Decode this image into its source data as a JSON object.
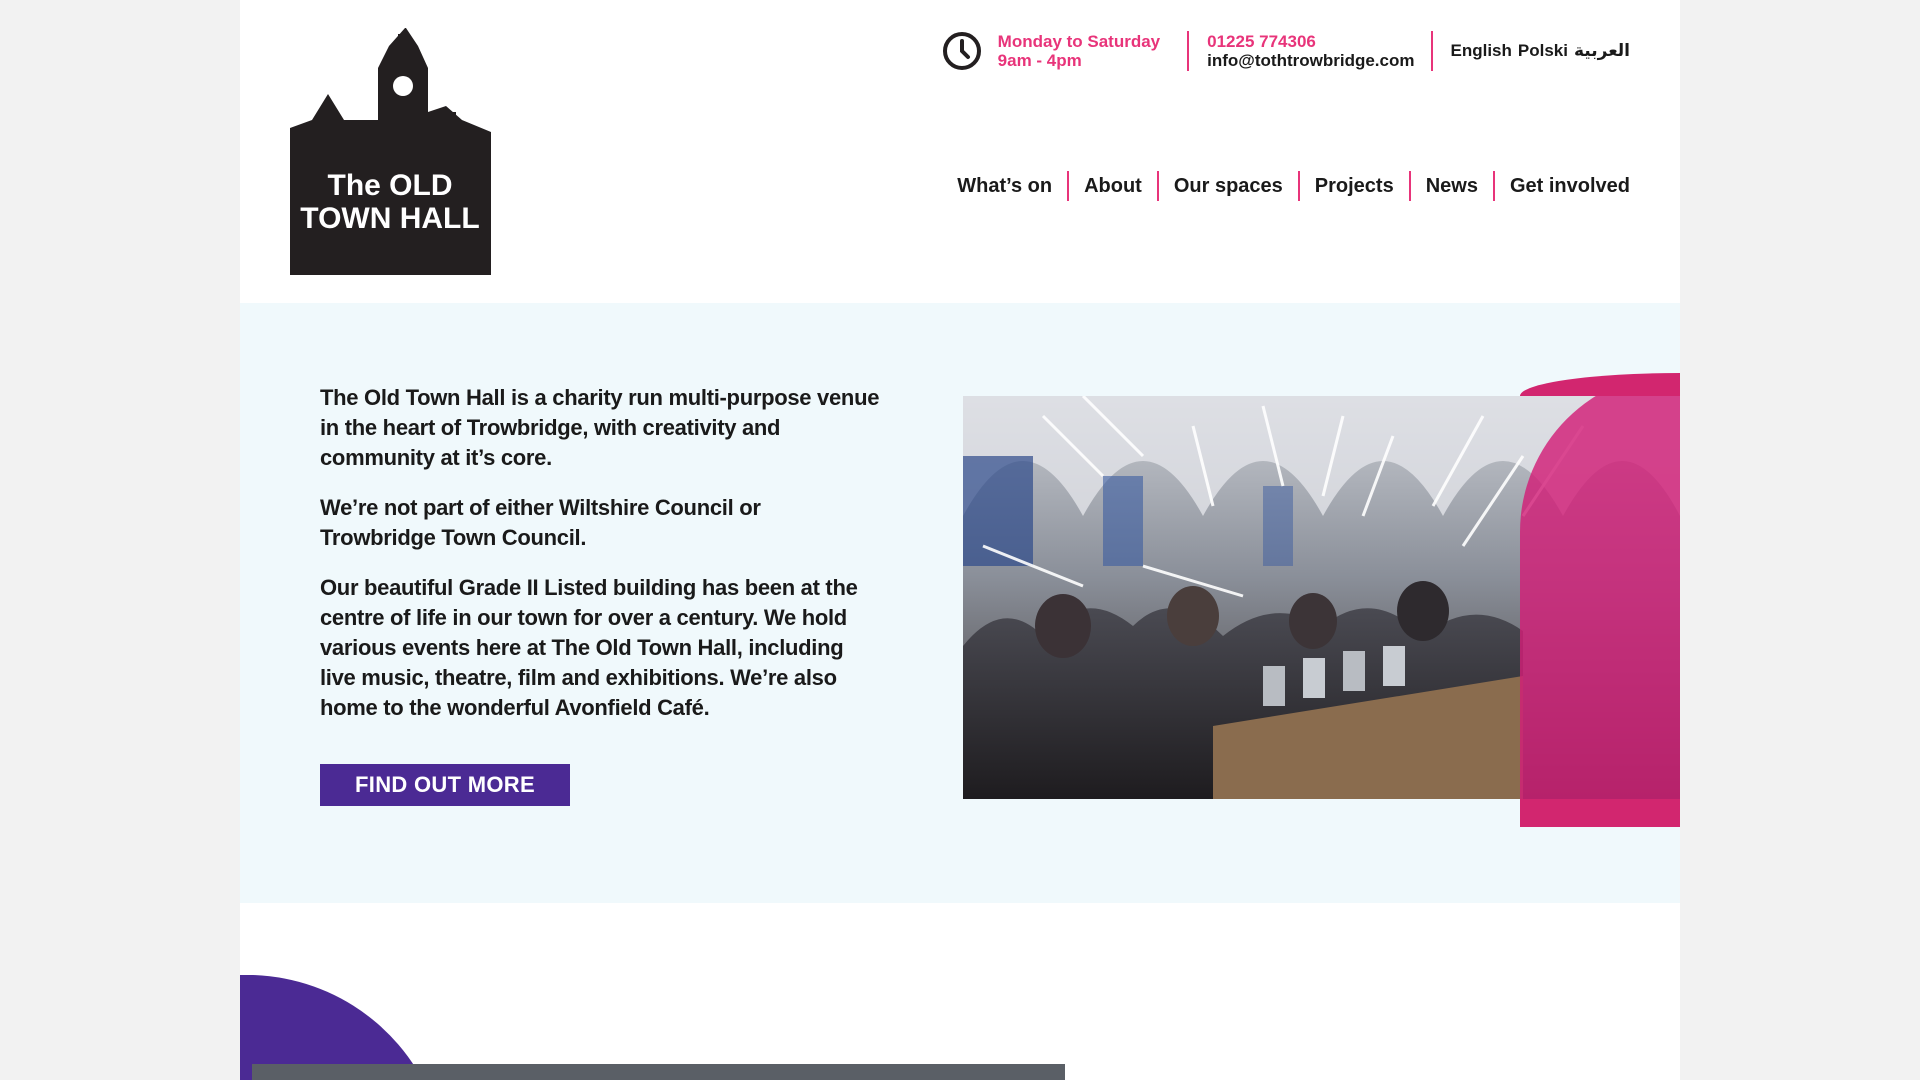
{
  "brand": {
    "logo_line1": "The OLD",
    "logo_line2": "TOWN HALL",
    "colors": {
      "pink": "#e8347a",
      "purple": "#4b2a94",
      "dark": "#231f20",
      "hero_bg": "#f0f9fc"
    }
  },
  "info_bar": {
    "clock_icon": "clock-icon",
    "hours_days": "Monday to Saturday",
    "hours_time": "9am - 4pm",
    "phone": "01225 774306",
    "email": "info@tothtrowbridge.com",
    "languages": [
      "English",
      "Polski",
      "العربية"
    ]
  },
  "nav": {
    "items": [
      "What’s on",
      "About",
      "Our spaces",
      "Projects",
      "News",
      "Get involved"
    ]
  },
  "hero": {
    "paragraphs": [
      "The Old Town Hall is a charity run multi-purpose venue in the heart of Trowbridge, with creativity and community at it’s core.",
      "We’re not part of either Wiltshire Council or Trowbridge Town Council.",
      "Our beautiful Grade II Listed building has been at the centre of life in our town for over a century. We hold various events here at The Old Town Hall, including live music, theatre, film and exhibitions. We’re also home to the wonderful Avonfield Café."
    ],
    "cta_label": "Find out more"
  }
}
